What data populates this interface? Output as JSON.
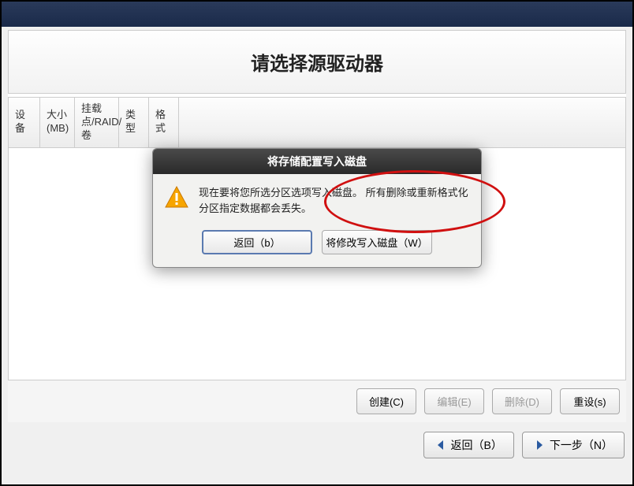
{
  "main": {
    "title": "请选择源驱动器",
    "columns": {
      "device": "设备",
      "size": "大小(MB)",
      "mount": "挂载点/RAID/卷",
      "type": "类型",
      "format": "格式"
    }
  },
  "dialog": {
    "title": "将存储配置写入磁盘",
    "message": "现在要将您所选分区选项写入磁盘。 所有删除或重新格式化分区指定数据都会丢失。",
    "back_button": "返回（b）",
    "write_button": "将修改写入磁盘（W）"
  },
  "actions": {
    "create": "创建(C)",
    "edit": "编辑(E)",
    "delete": "删除(D)",
    "reset": "重设(s)"
  },
  "nav": {
    "back": "返回（B）",
    "next": "下一步（N）"
  }
}
